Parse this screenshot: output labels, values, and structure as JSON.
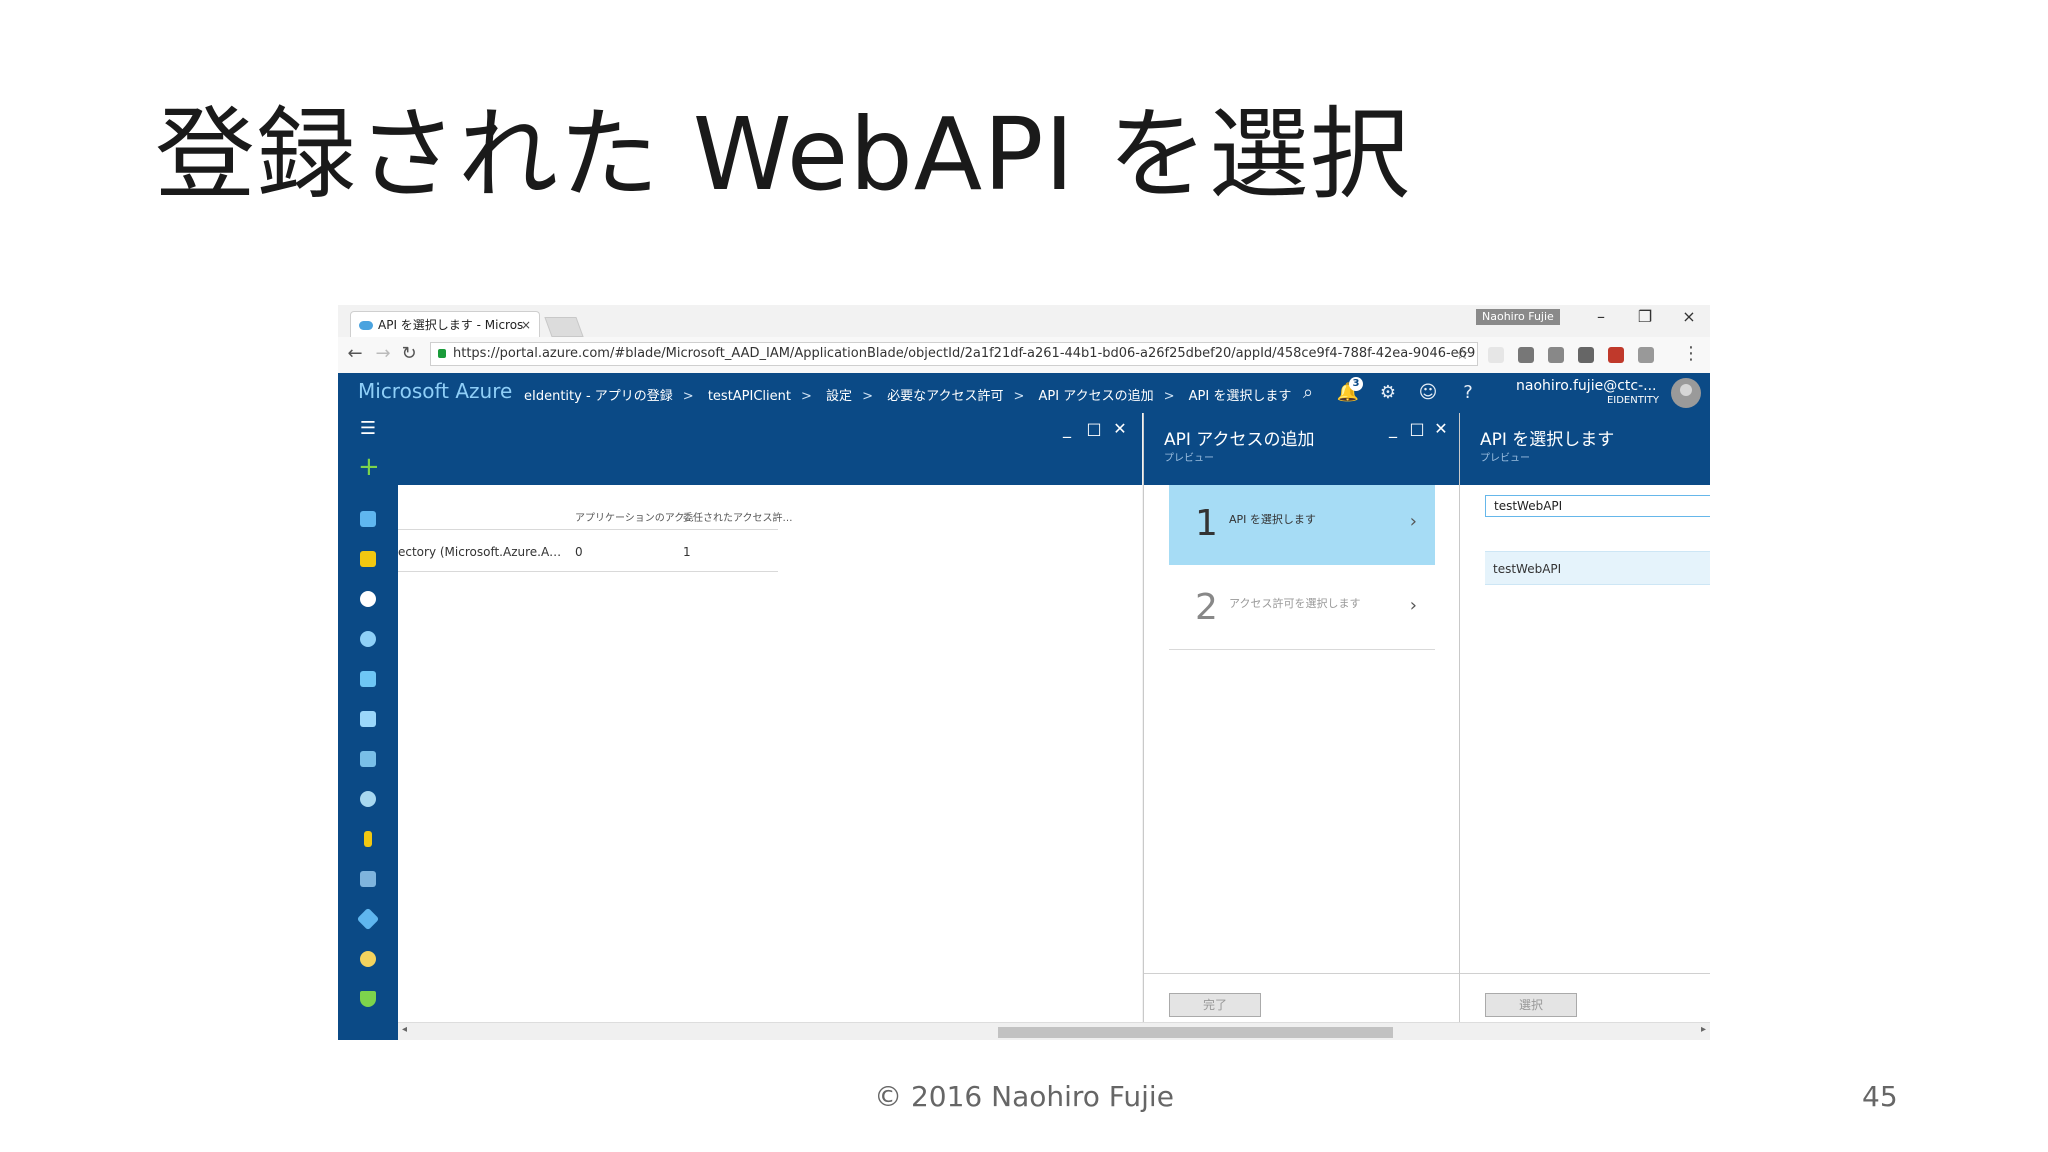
{
  "slide": {
    "title": "登録された WebAPI を選択",
    "footer": "© 2016 Naohiro Fujie",
    "page_number": "45"
  },
  "browser": {
    "tab_title": "API を選択します - Micros",
    "tab_close": "×",
    "profile_name": "Naohiro Fujie",
    "window_controls": {
      "minimize": "–",
      "restore": "❐",
      "close": "×"
    },
    "url": "https://portal.azure.com/#blade/Microsoft_AAD_IAM/ApplicationBlade/objectId/2a1f21df-a261-44b1-bd06-a26f25dbef20/appId/458ce9f4-788f-42ea-9046-e69",
    "icons": {
      "back": "arrow-left-icon",
      "forward": "arrow-right-icon",
      "reload": "reload-icon",
      "bookmark": "star-icon"
    }
  },
  "portal": {
    "brand": "Microsoft Azure",
    "breadcrumbs": [
      "eIdentity - アプリの登録",
      "testAPIClient",
      "設定",
      "必要なアクセス許可",
      "API アクセスの追加",
      "API を選択します"
    ],
    "breadcrumb_separator": ">",
    "notification_count": "3",
    "user_name": "naohiro.fujie@ctc-...",
    "tenant": "EIDENTITY",
    "colors": {
      "header": "#0b4a86",
      "brand_text": "#8fcff8",
      "plus_green": "#7dd44c",
      "selected_step": "#a6dcf5"
    }
  },
  "sidebar": {
    "menu_icon": "☰",
    "plus_icon": "+",
    "items": [
      "cube-icon",
      "grid-icon",
      "clock-icon",
      "globe-icon",
      "sql-database-icon",
      "virtual-machine-icon",
      "monitor-icon",
      "cloud-services-icon",
      "key-icon",
      "storage-icon",
      "diamond-icon",
      "timer-icon",
      "shield-icon"
    ]
  },
  "blade1": {
    "col_headers": [
      "アプリケーションのアク…",
      "委任されたアクセス許…"
    ],
    "row": {
      "name": "ectory (Microsoft.Azure.A…",
      "app_count": "0",
      "delegated_count": "1"
    }
  },
  "blade2": {
    "title": "API アクセスの追加",
    "subtitle": "プレビュー",
    "steps": [
      {
        "num": "1",
        "label": "API を選択します"
      },
      {
        "num": "2",
        "label": "アクセス許可を選択します"
      }
    ],
    "done_label": "完了"
  },
  "blade3": {
    "title": "API を選択します",
    "subtitle": "プレビュー",
    "filter_value": "testWebAPI",
    "results": [
      "testWebAPI"
    ],
    "select_label": "選択"
  },
  "blade_controls": {
    "minimize": "_",
    "maximize": "□",
    "close": "✕"
  }
}
